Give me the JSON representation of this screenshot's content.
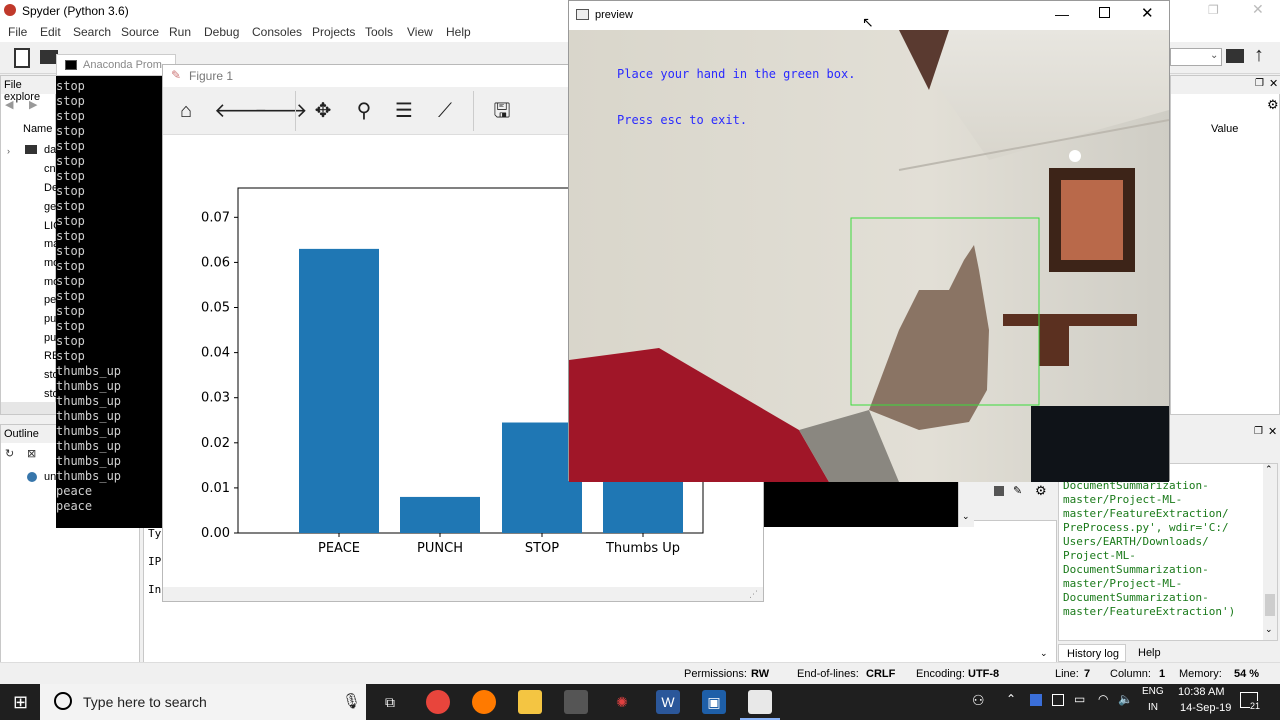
{
  "spyder": {
    "title": "Spyder (Python 3.6)",
    "menu": [
      "File",
      "Edit",
      "Search",
      "Source",
      "Run",
      "Debug",
      "Consoles",
      "Projects",
      "Tools",
      "View",
      "Help"
    ],
    "file_explorer_label": "File explore",
    "name_col": "Name",
    "value_col": "Value",
    "file_items": [
      "da",
      "cn",
      "De",
      "ge",
      "LIC",
      "ma",
      "mo",
      "mo",
      "pe",
      "pu",
      "pu",
      "RE",
      "sto",
      "sto"
    ],
    "outline_label": "Outline",
    "outline_item": "un",
    "ipy_lines": [
      "Ty",
      "IP",
      "In"
    ],
    "history_tabs": [
      "History log",
      "Help"
    ],
    "history_text": "t-ML-\nDocumentSummarization-\nmaster/Project-ML-\nmaster/FeatureExtraction/\nPreProcess.py', wdir='C:/\nUsers/EARTH/Downloads/\nProject-ML-\nDocumentSummarization-\nmaster/Project-ML-\nDocumentSummarization-\nmaster/FeatureExtraction')"
  },
  "anaconda": {
    "title": "Anaconda Prom",
    "lines": [
      "stop",
      "stop",
      "stop",
      "stop",
      "stop",
      "stop",
      "stop",
      "stop",
      "stop",
      "stop",
      "stop",
      "stop",
      "stop",
      "stop",
      "stop",
      "stop",
      "stop",
      "stop",
      "stop",
      "thumbs_up",
      "thumbs_up",
      "thumbs_up",
      "thumbs_up",
      "thumbs_up",
      "thumbs_up",
      "thumbs_up",
      "thumbs_up",
      "peace",
      "peace"
    ]
  },
  "figure": {
    "title": "Figure 1"
  },
  "chart_data": {
    "type": "bar",
    "categories": [
      "PEACE",
      "PUNCH",
      "STOP",
      "Thumbs Up"
    ],
    "values": [
      0.063,
      0.008,
      0.0245,
      0.014
    ],
    "yticks": [
      "0.00",
      "0.01",
      "0.02",
      "0.03",
      "0.04",
      "0.05",
      "0.06",
      "0.07"
    ],
    "ylim": [
      0,
      0.0765
    ],
    "color": "#1f77b4"
  },
  "preview": {
    "title": "preview",
    "line1": "Place your hand in the green box.",
    "line2": "Press esc to exit.",
    "text_color": "#2a2aff",
    "box_color": "#3cdc3c"
  },
  "statusbar": {
    "permissions_label": "Permissions:",
    "permissions": "RW",
    "eol_label": "End-of-lines:",
    "eol": "CRLF",
    "encoding_label": "Encoding:",
    "encoding": "UTF-8",
    "line_label": "Line:",
    "line": "7",
    "column_label": "Column:",
    "column": "1",
    "memory_label": "Memory:",
    "memory": "54 %"
  },
  "taskbar": {
    "search_placeholder": "Type here to search",
    "lang1": "ENG",
    "lang2": "IN",
    "time": "10:38 AM",
    "date": "14-Sep-19",
    "notif_count": "21"
  }
}
